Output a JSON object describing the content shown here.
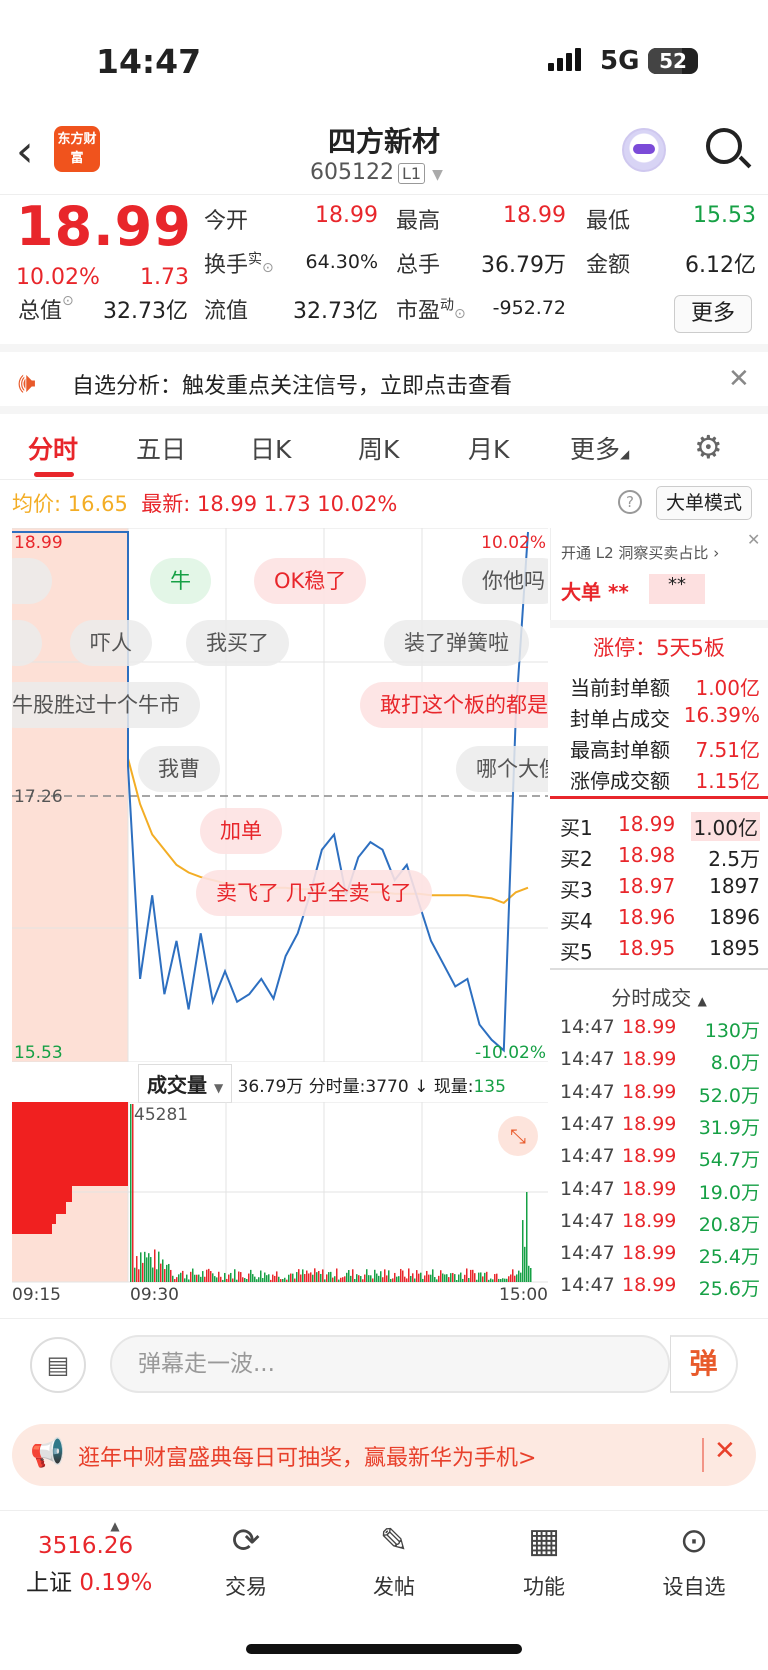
{
  "status": {
    "time": "14:47",
    "network": "5G",
    "battery": "52"
  },
  "header": {
    "title": "四方新材",
    "code": "605122",
    "level": "L1",
    "logo_text": "东方财富"
  },
  "quote": {
    "price": "18.99",
    "change_pct": "10.02%",
    "change": "1.73",
    "open_label": "今开",
    "open": "18.99",
    "high_label": "最高",
    "high": "18.99",
    "low_label": "最低",
    "low": "15.53",
    "turnover_label": "换手",
    "turnover_sup": "实",
    "turnover": "64.30%",
    "volume_label": "总手",
    "volume": "36.79万",
    "amount_label": "金额",
    "amount": "6.12亿",
    "mktcap_label": "总值",
    "mktcap": "32.73亿",
    "float_label": "流值",
    "float": "32.73亿",
    "pe_label": "市盈",
    "pe_sup": "动",
    "pe": "-952.72",
    "more_button": "更多"
  },
  "notice": {
    "text": "自选分析：触发重点关注信号，立即点击查看"
  },
  "tabs": [
    "分时",
    "五日",
    "日K",
    "周K",
    "月K",
    "更多"
  ],
  "chart_info": {
    "avg_label": "均价:",
    "avg": "16.65",
    "latest_label": "最新:",
    "latest": "18.99",
    "latest_chg": "1.73",
    "latest_pct": "10.02%",
    "mode_button": "大单模式"
  },
  "chart_data": {
    "type": "line",
    "y_high": "18.99",
    "y_mid": "17.26",
    "y_low": "15.53",
    "pct_high": "10.02%",
    "pct_low": "-10.02%",
    "ylim": [
      15.53,
      18.99
    ],
    "series": [
      {
        "values": [
          18.99,
          18.99,
          18.99,
          17.45,
          16.05,
          16.6,
          15.95,
          16.3,
          15.85,
          16.35,
          15.9,
          16.1,
          15.9,
          15.95,
          16.05,
          15.92,
          16.2,
          16.35,
          16.6,
          16.9,
          17.0,
          16.6,
          16.85,
          16.95,
          16.9,
          16.7,
          16.8,
          16.55,
          16.3,
          16.15,
          16.0,
          16.05,
          15.75,
          15.65,
          15.58,
          17.8,
          18.99
        ]
      },
      {
        "values": [
          18.99,
          18.99,
          18.99,
          17.5,
          17.2,
          17.0,
          16.9,
          16.8,
          16.75,
          16.72,
          16.7,
          16.68,
          16.67,
          16.66,
          16.66,
          16.65,
          16.65,
          16.64,
          16.64,
          16.63,
          16.63,
          16.62,
          16.62,
          16.62,
          16.62,
          16.61,
          16.61,
          16.61,
          16.6,
          16.6,
          16.6,
          16.6,
          16.59,
          16.58,
          16.55,
          16.62,
          16.65
        ]
      }
    ]
  },
  "danmu": [
    {
      "text": "牛",
      "style": "green"
    },
    {
      "text": "OK稳了",
      "style": "pink"
    },
    {
      "text": "你他吗",
      "style": "gray"
    },
    {
      "text": "吓人",
      "style": "gray"
    },
    {
      "text": "我买了",
      "style": "gray"
    },
    {
      "text": "装了弹簧啦",
      "style": "gray"
    },
    {
      "text": "牛股胜过十个牛市",
      "style": "gray"
    },
    {
      "text": "敢打这个板的都是",
      "style": "pink"
    },
    {
      "text": "我曹",
      "style": "gray"
    },
    {
      "text": "哪个大傻",
      "style": "gray"
    },
    {
      "text": "加单",
      "style": "pink"
    },
    {
      "text": "卖飞了 几乎全卖飞了",
      "style": "pink"
    }
  ],
  "volume": {
    "selector": "成交量",
    "total": "36.79万",
    "minute_label": "分时量:",
    "minute": "3770",
    "arrow": "↓",
    "now_label": "现量:",
    "now": "135",
    "max": "45281",
    "t_start": "09:15",
    "t_open": "09:30",
    "t_close": "15:00"
  },
  "side": {
    "l2": "开通 L2 洞察买卖占比 ›",
    "bigorder_label": "大单",
    "bigorder_a": "**",
    "bigorder_b": "**",
    "limit_title": "涨停：5天5板",
    "stats": [
      {
        "k": "当前封单额",
        "v": "1.00亿"
      },
      {
        "k": "封单占成交",
        "v": "16.39%"
      },
      {
        "k": "最高封单额",
        "v": "7.51亿"
      },
      {
        "k": "涨停成交额",
        "v": "1.15亿"
      }
    ],
    "bids": [
      {
        "k": "买1",
        "p": "18.99",
        "q": "1.00亿"
      },
      {
        "k": "买2",
        "p": "18.98",
        "q": "2.5万"
      },
      {
        "k": "买3",
        "p": "18.97",
        "q": "1897"
      },
      {
        "k": "买4",
        "p": "18.96",
        "q": "1896"
      },
      {
        "k": "买5",
        "p": "18.95",
        "q": "1895"
      }
    ],
    "trades_title": "分时成交",
    "trades": [
      {
        "t": "14:47",
        "p": "18.99",
        "q": "130万"
      },
      {
        "t": "14:47",
        "p": "18.99",
        "q": "8.0万"
      },
      {
        "t": "14:47",
        "p": "18.99",
        "q": "52.0万"
      },
      {
        "t": "14:47",
        "p": "18.99",
        "q": "31.9万"
      },
      {
        "t": "14:47",
        "p": "18.99",
        "q": "54.7万"
      },
      {
        "t": "14:47",
        "p": "18.99",
        "q": "19.0万"
      },
      {
        "t": "14:47",
        "p": "18.99",
        "q": "20.8万"
      },
      {
        "t": "14:47",
        "p": "18.99",
        "q": "25.4万"
      },
      {
        "t": "14:47",
        "p": "18.99",
        "q": "25.6万"
      }
    ]
  },
  "input": {
    "placeholder": "弹幕走一波...",
    "danmu_btn": "弹"
  },
  "banner": {
    "text": "逛年中财富盛典每日可抽奖，赢最新华为手机>"
  },
  "bottom": {
    "index_value": "3516.26",
    "index_name": "上证",
    "index_pct": "0.19%",
    "items": [
      "交易",
      "发帖",
      "功能",
      "设自选"
    ]
  },
  "colors": {
    "up": "#e8262b",
    "down": "#16a045",
    "price_line": "#2d6fc0",
    "avg_line": "#f3ad25"
  }
}
